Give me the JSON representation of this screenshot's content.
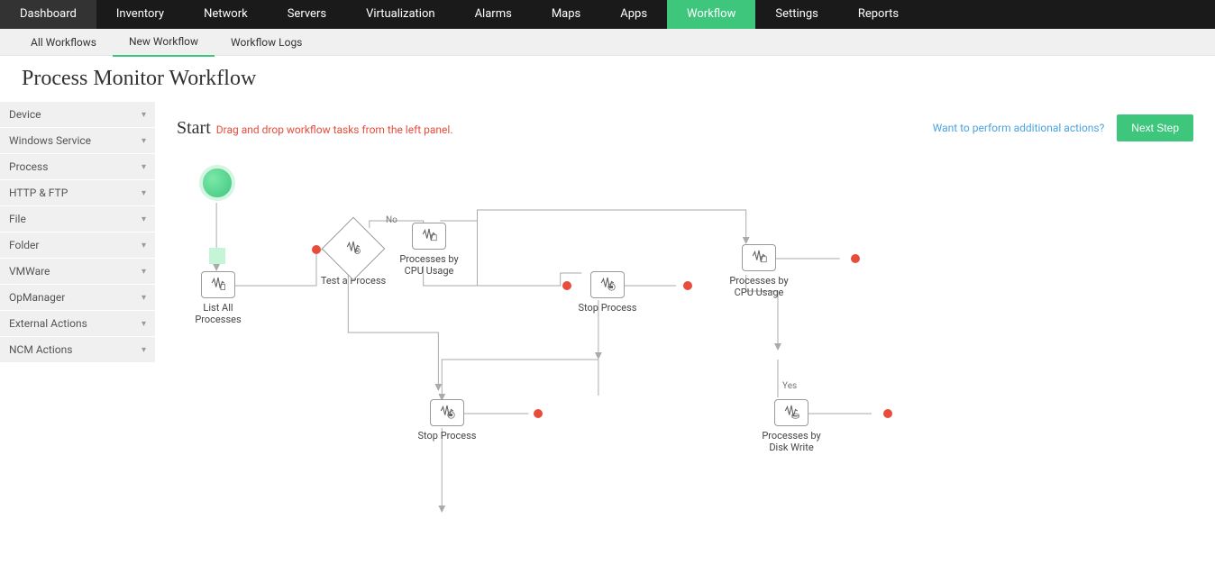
{
  "topnav": {
    "items": [
      "Dashboard",
      "Inventory",
      "Network",
      "Servers",
      "Virtualization",
      "Alarms",
      "Maps",
      "Apps",
      "Workflow",
      "Settings",
      "Reports"
    ],
    "active": "Workflow"
  },
  "subnav": {
    "items": [
      "All Workflows",
      "New Workflow",
      "Workflow Logs"
    ],
    "active": "New Workflow"
  },
  "page_title": "Process Monitor Workflow",
  "sidebar": {
    "items": [
      "Device",
      "Windows Service",
      "Process",
      "HTTP & FTP",
      "File",
      "Folder",
      "VMWare",
      "OpManager",
      "External Actions",
      "NCM Actions"
    ]
  },
  "canvas": {
    "start_label": "Start",
    "hint": "Drag and drop workflow tasks from the left panel.",
    "additional_link": "Want to perform additional actions?",
    "next_button": "Next Step",
    "nodes": {
      "list_all": "List All Processes",
      "test": "Test a Process",
      "no_label": "No",
      "yes_label": "Yes",
      "proc_cpu_1": "Processes by CPU Usage",
      "stop_1": "Stop Process",
      "proc_cpu_2": "Processes by CPU Usage",
      "stop_2": "Stop Process",
      "proc_disk": "Processes by Disk Write"
    }
  }
}
